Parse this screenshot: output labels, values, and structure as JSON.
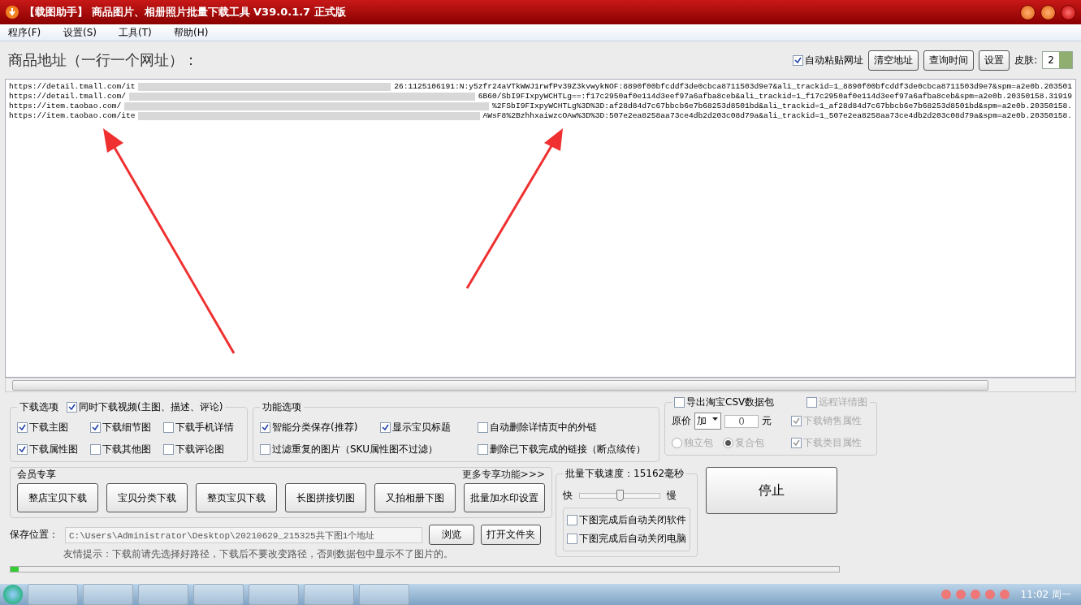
{
  "window": {
    "title": "【载图助手】 商品图片、相册照片批量下载工具 V39.0.1.7 正式版"
  },
  "menu": [
    {
      "label": "程序(F)"
    },
    {
      "label": "设置(S)"
    },
    {
      "label": "工具(T)"
    },
    {
      "label": "帮助(H)"
    }
  ],
  "address_label": "商品地址（一行一个网址）：",
  "auto_paste": {
    "label": "自动粘贴网址",
    "checked": true
  },
  "top_buttons": [
    "清空地址",
    "查询时间",
    "设置"
  ],
  "skin": {
    "label": "皮肤:",
    "value": "2"
  },
  "url_lines": [
    {
      "start": "https://detail.tmall.com/it",
      "end": "26:1125106191:N:y5zfr24aVTkWWJ1rwfPv39Z3kvwykNOF:8890f00bfcddf3de0cbca8711503d9e7&ali_trackid=1_8890f00bfcddf3de0cbca8711503d9e7&spm=a2e0b.203501"
    },
    {
      "start": "https://detail.tmall.com/",
      "end": "6B60/SbI9FIxpyWCHTLg==:f17c2950af0e114d3eef97a6afba8ceb&ali_trackid=1_f17c2950af0e114d3eef97a6afba8ceb&spm=a2e0b.20350158.31919"
    },
    {
      "start": "https://item.taobao.com/",
      "end": "%2FSbI9FIxpyWCHTLg%3D%3D:af28d84d7c67bbcb6e7b68253d8501bd&ali_trackid=1_af28d84d7c67bbcb6e7b68253d8501bd&spm=a2e0b.20350158."
    },
    {
      "start": "https://item.taobao.com/ite",
      "end": "AWsF8%2BzhhxaiwzcOAw%3D%3D:507e2ea8258aa73ce4db2d203c08d79a&ali_trackid=1_507e2ea8258aa73ce4db2d203c08d79a&spm=a2e0b.20350158."
    }
  ],
  "download_options": {
    "title": "下载选项",
    "video": {
      "label": "同时下载视频(主图、描述、评论)",
      "checked": true
    },
    "items": [
      {
        "label": "下载主图",
        "checked": true
      },
      {
        "label": "下载细节图",
        "checked": true
      },
      {
        "label": "下载手机详情",
        "checked": false
      },
      {
        "label": "下载属性图",
        "checked": true
      },
      {
        "label": "下载其他图",
        "checked": false
      },
      {
        "label": "下载评论图",
        "checked": false
      }
    ]
  },
  "function_options": {
    "title": "功能选项",
    "items": [
      {
        "label": "智能分类保存(推荐)",
        "checked": true
      },
      {
        "label": "显示宝贝标题",
        "checked": true
      },
      {
        "label": "自动删除详情页中的外链",
        "checked": false
      },
      {
        "label": "过滤重复的图片（SKU属性图不过滤）",
        "checked": false
      },
      {
        "label": "删除已下载完成的链接（断点续传）",
        "checked": false
      }
    ]
  },
  "export": {
    "csv": {
      "label": "导出淘宝CSV数据包",
      "checked": false
    },
    "remote": {
      "label": "远程详情图",
      "checked": false,
      "disabled": true
    },
    "price_label": "原价",
    "price_mode": "加",
    "price_value": "0",
    "unit": "元",
    "attrs": [
      {
        "label": "下载销售属性",
        "checked": true,
        "disabled": true
      },
      {
        "label": "下载类目属性",
        "checked": true,
        "disabled": true
      }
    ],
    "packages": [
      {
        "label": "独立包",
        "selected": false,
        "disabled": true
      },
      {
        "label": "复合包",
        "selected": true,
        "disabled": true
      }
    ]
  },
  "member": {
    "title": "会员专享",
    "more_link": "更多专享功能>>>",
    "buttons": [
      "整店宝贝下载",
      "宝贝分类下载",
      "整页宝贝下载",
      "长图拼接切图",
      "又拍相册下图",
      "批量加水印设置"
    ]
  },
  "speed": {
    "title": "批量下载速度：15162毫秒",
    "fast": "快",
    "slow": "慢",
    "level": 0.5,
    "options": [
      {
        "label": "下图完成后自动关闭软件",
        "checked": false
      },
      {
        "label": "下图完成后自动关闭电脑",
        "checked": false
      }
    ]
  },
  "stop_button": "停止",
  "save": {
    "label": "保存位置：",
    "path": "C:\\Users\\Administrator\\Desktop\\20210629_215325共下图1个地址",
    "browse": "浏览",
    "open_folder": "打开文件夹"
  },
  "tip": "友情提示：下载前请先选择好路径，下载后不要改变路径，否则数据包中显示不了图片的。",
  "progress": {
    "level": 0.01
  },
  "taskbar": {
    "clock": "11:02 周一"
  }
}
